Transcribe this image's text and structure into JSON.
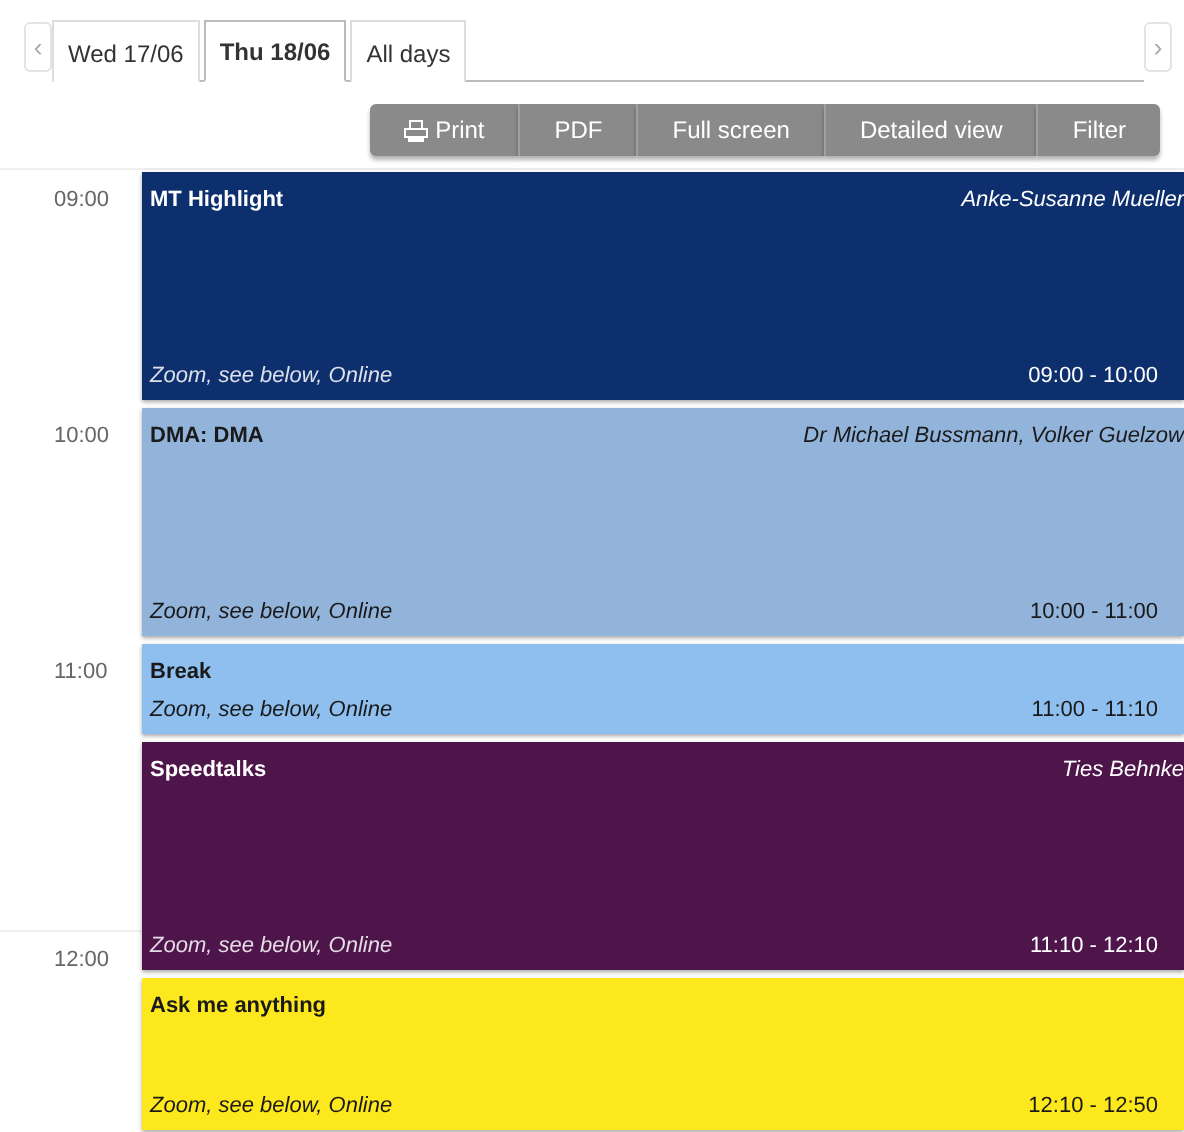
{
  "day_tabs": {
    "prev": "‹",
    "next": "›",
    "tabs": [
      {
        "label": "Wed 17/06",
        "selected": false
      },
      {
        "label": "Thu 18/06",
        "selected": true
      },
      {
        "label": "All days",
        "selected": false
      }
    ]
  },
  "toolbar": [
    {
      "label": "Print",
      "kind": "print"
    },
    {
      "label": "PDF",
      "kind": "plain"
    },
    {
      "label": "Full screen",
      "kind": "plain"
    },
    {
      "label": "Detailed view",
      "kind": "plain"
    },
    {
      "label": "Filter",
      "kind": "plain"
    }
  ],
  "events": [
    {
      "title": "MT Highlight",
      "speaker": "Anke-Susanne Mueller",
      "location": "Zoom, see below, Online",
      "time": "09:00 - 10:00",
      "color": "#0e2f6d",
      "hour": "09:00"
    },
    {
      "title": "DMA: DMA",
      "speaker": "Dr Michael Bussmann, Volker Guelzow",
      "location": "Zoom, see below, Online",
      "time": "10:00 - 11:00",
      "color": "#92b4db",
      "hour": "10:00"
    },
    {
      "title": "Break",
      "location": "Zoom, see below, Online",
      "time": "11:00 - 11:10",
      "color": "#8ebfef",
      "hour": "11:00"
    },
    {
      "title": "Speedtalks",
      "speaker": "Ties Behnke",
      "location": "Zoom, see below, Online",
      "time": "11:10 - 12:10",
      "color": "#4e154b",
      "hour_end": "12:00"
    },
    {
      "title": "Ask me anything",
      "location": "Zoom, see below, Online",
      "time": "12:10 - 12:50",
      "color": "#fde81d"
    }
  ]
}
